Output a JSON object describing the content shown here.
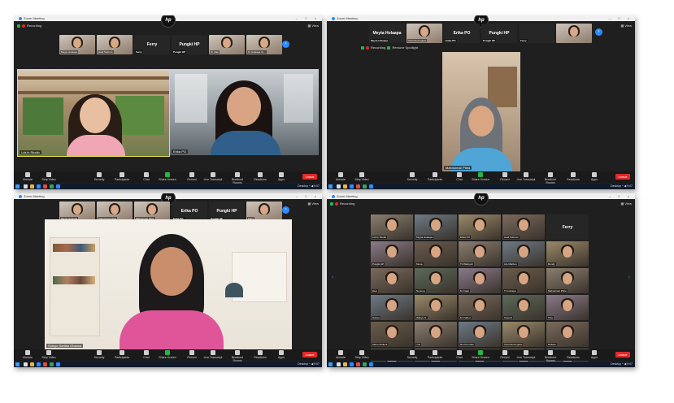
{
  "common": {
    "app_title": "Zoom Meeting",
    "recording": "Recording",
    "remove_spotlight": "Remove Spotlight",
    "view": "View",
    "hp_logo": "hp",
    "next_page": "›",
    "prev_page": "‹",
    "leave": "Leave",
    "window_controls": "– □ ×",
    "tray_time": "Desktop ^ ◀ 9:07",
    "toolbar": [
      "Unmute",
      "Stop Video",
      "Security",
      "Participants",
      "Chat",
      "Share Screen",
      "Record",
      "Live Transcript",
      "Breakout Rooms",
      "Reactions",
      "Apps"
    ]
  },
  "panel1": {
    "strip": [
      {
        "type": "photo",
        "label": "Meyta Holaapa"
      },
      {
        "type": "photo",
        "label": "Hadi Subroto"
      },
      {
        "type": "name",
        "text": "Ferry",
        "label": "Ferry"
      },
      {
        "type": "name",
        "text": "Pungki HP",
        "label": "Pungki HP"
      },
      {
        "type": "photo",
        "label": "M. Zaki"
      },
      {
        "type": "photo",
        "label": "M. Holaapa Gi..."
      }
    ],
    "speaker_left": "Lulu's Studio",
    "speaker_right": "Erika PO"
  },
  "panel2": {
    "strip": [
      {
        "type": "name",
        "text": "Meyta Holaapa",
        "label": "Meyta Holaapa"
      },
      {
        "type": "photo",
        "label": "Vivit Pamungkas"
      },
      {
        "type": "name",
        "text": "Erika PO",
        "label": "Erika PO"
      },
      {
        "type": "name",
        "text": "Pungki HP",
        "label": "Pungki HP"
      },
      {
        "type": "name",
        "text": "",
        "label": "Ferry"
      },
      {
        "type": "photo",
        "label": ""
      }
    ],
    "speaker": "Mahnoimar Pitria"
  },
  "panel3": {
    "strip": [
      {
        "type": "photo",
        "label": "Meyta Holaapa"
      },
      {
        "type": "photo",
        "label": "Vivit Pamungkas"
      },
      {
        "type": "photo",
        "label": "Mahnoimar Pitria"
      },
      {
        "type": "name",
        "text": "Erika PO",
        "label": "Erika PO"
      },
      {
        "type": "name",
        "text": "Pungki HP",
        "label": "Pungki HP"
      },
      {
        "type": "photo",
        "label": "Ferry"
      }
    ],
    "speaker": "Sutoyo Sartika Gbansa"
  },
  "panel4": {
    "gallery": [
      "Lulu's Studio",
      "Meyta Holaapa",
      "Erika PO",
      "Hadi Subroto",
      "Ferry",
      "Pungki HP",
      "Mona",
      "Tri Wahyuni",
      "Lilo Marbun",
      "Dendy",
      "Dea",
      "Nunung",
      "M. Fajar",
      "Tri Cahaya",
      "Mahnoimar Pitria",
      "Sutoyo",
      "Wahyu S.",
      "M. Fathul",
      "Susanti",
      "Tina",
      "Maria Widiarti",
      "Yuli",
      "Rio Permata",
      "Vivit Pamungkas",
      "Ridwan",
      "Bambang",
      "Andreas",
      "Intan",
      "Nur",
      "Adam Pratama"
    ],
    "named_index": 4
  }
}
